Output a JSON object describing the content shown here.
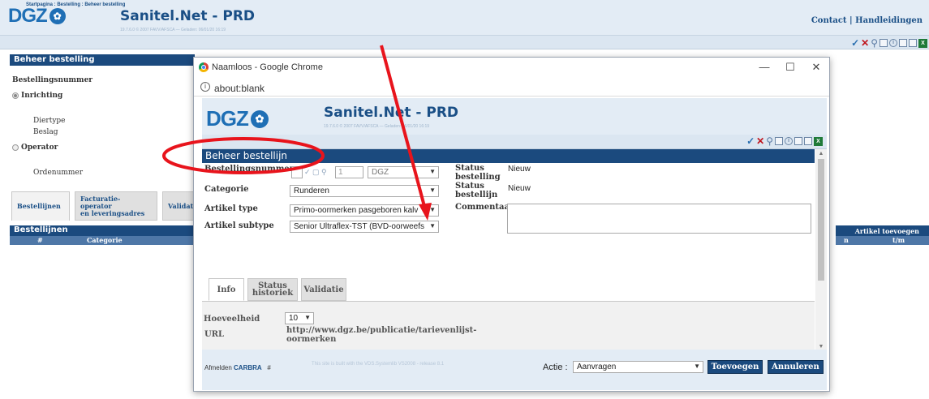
{
  "background": {
    "logo_text": "DGZ",
    "app_title": "Sanitel.Net - PRD",
    "app_subtitle": "19.7.6.0 © 2007 FAVV/AFSCA — Geladen: 06/01/20 16:19",
    "header_links": "Contact | Handleidingen",
    "breadcrumb": "Startpagina : Bestelling : Beheer bestelling",
    "section_title": "Beheer bestelling",
    "bestellingsnummer_label": "Bestellingsnummer",
    "inrichting_label": "Inrichting",
    "diertype_label": "Diertype",
    "beslag_label": "Beslag",
    "operator_label": "Operator",
    "ordenummer_label": "Ordenummer",
    "tabs": [
      {
        "line1": "Bestellijnen",
        "line2": ""
      },
      {
        "line1": "Facturatie-",
        "line2": "operator",
        "line3": "en leveringsadres"
      },
      {
        "line1": "Validat",
        "line2": ""
      }
    ],
    "list_title": "Bestellijnen",
    "list_col_hash": "#",
    "list_col_categorie": "Categorie",
    "artikel_toevoegen": "Artikel toevoegen",
    "right_col_n": "n",
    "right_col_tm": "t/m"
  },
  "popup": {
    "window_title": "Naamloos - Google Chrome",
    "address": "about:blank",
    "logo_text": "DGZ",
    "app_title": "Sanitel.Net - PRD",
    "app_subtitle": "19.7.6.0 © 2007 FAVV/AFSCA — Geladen: 06/01/20 16:19",
    "section_title": "Beheer bestellijn",
    "bestellingsnummer_label": "Bestellingsnummer",
    "bestellingsnummer_input": "1",
    "bestellingsnummer_select": "DGZ",
    "status_bestelling_label_1": "Status",
    "status_bestelling_label_2": "bestelling",
    "status_bestelling_value": "Nieuw",
    "categorie_label": "Categorie",
    "categorie_value": "Runderen",
    "status_bestellijn_label_1": "Status",
    "status_bestellijn_label_2": "bestellijn",
    "status_bestellijn_value": "Nieuw",
    "artikel_type_label": "Artikel type",
    "artikel_type_value": "Primo-oormerken pasgeboren kalv",
    "commentaar_label": "Commentaar",
    "artikel_subtype_label": "Artikel subtype",
    "artikel_subtype_value": "Senior Ultraflex-TST (BVD-oorweefs",
    "tabs": [
      {
        "line1": "Info",
        "line2": ""
      },
      {
        "line1": "Status",
        "line2": "historiek"
      },
      {
        "line1": "Validatie",
        "line2": ""
      }
    ],
    "url_label": "URL",
    "url_value_1": "http://www.dgz.be/publicatie/tarievenlijst-",
    "url_value_2": "oormerken",
    "hoeveelheid_label": "Hoeveelheid",
    "hoeveelheid_value": "10",
    "footer_afmelden": "Afmelden",
    "footer_user": "CARBRA",
    "footer_hash": "#",
    "footer_note": "This site is built with the VDS.Systemlib VS2008 - release 8.1",
    "actie_label": "Actie :",
    "actie_value": "Aanvragen",
    "toevoegen_label": "Toevoegen",
    "annuleren_label": "Annuleren"
  },
  "colors": {
    "brand_blue": "#1b4a7e",
    "header_bg": "#e3ecf5",
    "annotation_red": "#e8141c"
  }
}
